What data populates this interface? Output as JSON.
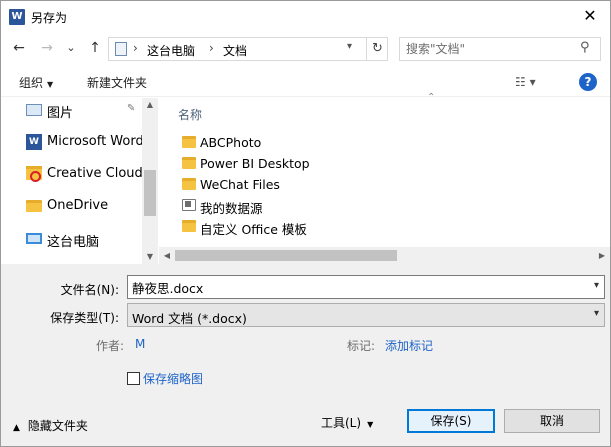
{
  "window": {
    "title": "另存为",
    "close_glyph": "✕"
  },
  "nav": {
    "back_glyph": "←",
    "forward_glyph": "→",
    "recent_glyph": "⌄",
    "up_glyph": "↑",
    "breadcrumb": [
      "这台电脑",
      "文档"
    ],
    "separator": "›",
    "refresh_glyph": "↻",
    "search_placeholder": "搜索\"文档\"",
    "search_glyph": "⚲"
  },
  "toolbar": {
    "organize_label": "组织",
    "new_folder_label": "新建文件夹",
    "view_glyph": "☷ ▾",
    "help_glyph": "?"
  },
  "sidebar": {
    "items": [
      {
        "label": "图片",
        "icon": "picture-icon"
      },
      {
        "label": "Microsoft Word",
        "icon": "word-icon"
      },
      {
        "label": "Creative Cloud F",
        "icon": "creative-cloud-folder-icon"
      },
      {
        "label": "OneDrive",
        "icon": "folder-icon"
      },
      {
        "label": "这台电脑",
        "icon": "computer-icon"
      }
    ],
    "pin_glyph": "📌"
  },
  "files": {
    "column_name": "名称",
    "items": [
      {
        "label": "ABCPhoto",
        "type": "folder"
      },
      {
        "label": "Power BI Desktop",
        "type": "folder"
      },
      {
        "label": "WeChat Files",
        "type": "folder"
      },
      {
        "label": "我的数据源",
        "type": "datasource"
      },
      {
        "label": "自定义 Office 模板",
        "type": "folder"
      }
    ]
  },
  "form": {
    "filename_label": "文件名(N):",
    "filename_value": "静夜思.docx",
    "filetype_label": "保存类型(T):",
    "filetype_value": "Word 文档 (*.docx)",
    "author_label": "作者:",
    "author_value": "M",
    "tags_label": "标记:",
    "tags_value": "添加标记",
    "thumbnail_label": "保存缩略图"
  },
  "footer": {
    "hide_folders_label": "隐藏文件夹",
    "tools_label": "工具(L)",
    "save_label": "保存(S)",
    "cancel_label": "取消"
  },
  "colors": {
    "link": "#1e64c8",
    "primary_border": "#0078d7",
    "folder": "#f5c242"
  }
}
